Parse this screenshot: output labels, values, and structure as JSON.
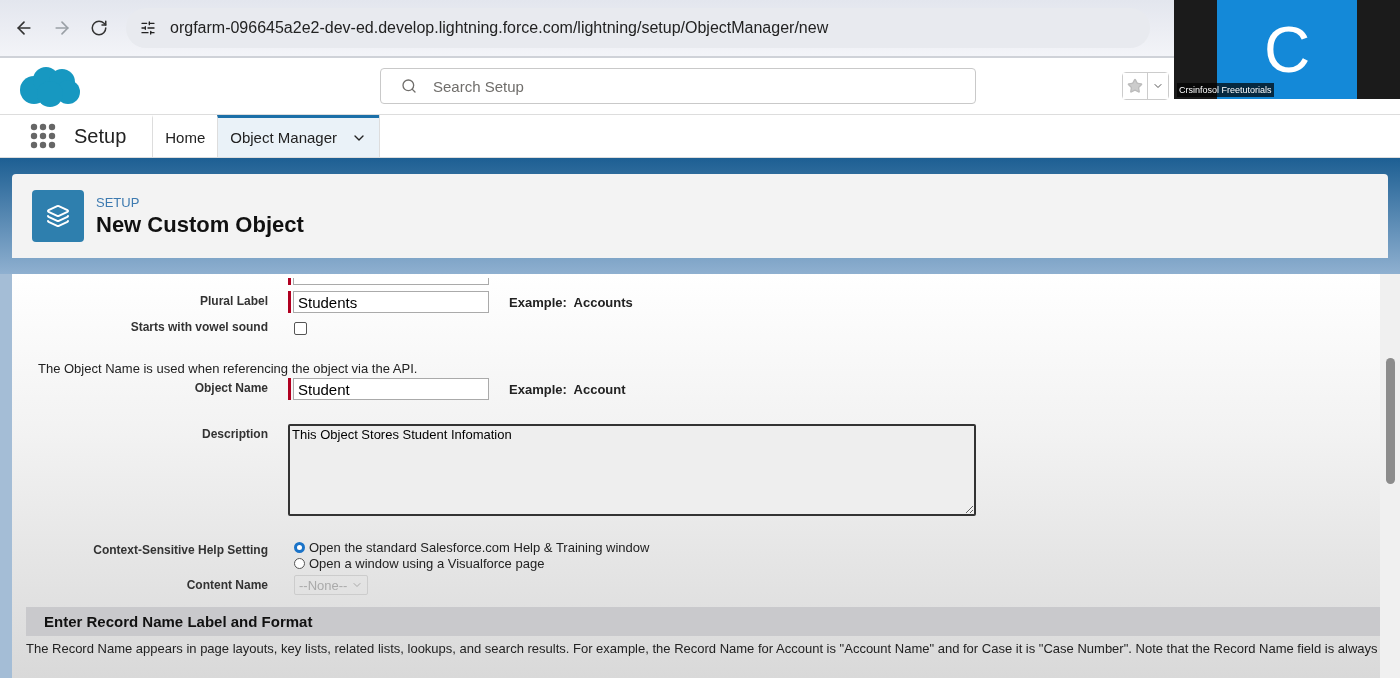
{
  "browser": {
    "url": "orgfarm-096645a2e2-dev-ed.develop.lightning.force.com/lightning/setup/ObjectManager/new"
  },
  "header": {
    "search": {
      "placeholder": "Search Setup"
    }
  },
  "video_tile": {
    "letter": "C",
    "name": "Crsinfosol Freetutorials"
  },
  "nav": {
    "app_name": "Setup",
    "tabs": [
      {
        "label": "Home",
        "selected": false,
        "dropdown": false
      },
      {
        "label": "Object Manager",
        "selected": true,
        "dropdown": true
      }
    ]
  },
  "page_header": {
    "eyebrow": "SETUP",
    "title": "New Custom Object"
  },
  "form": [
    {
      "kind": "cutfield",
      "required": true
    },
    {
      "kind": "text",
      "label": "Plural Label",
      "value": "Students",
      "required": true,
      "example": "Example:  Accounts"
    },
    {
      "kind": "checkbox",
      "label": "Starts with vowel sound",
      "checked": false
    },
    {
      "kind": "note",
      "text": "The Object Name is used when referencing the object via the API."
    },
    {
      "kind": "text",
      "label": "Object Name",
      "value": "Student",
      "required": true,
      "example": "Example:  Account"
    },
    {
      "kind": "textarea",
      "label": "Description",
      "value": "This Object Stores Student Infomation"
    },
    {
      "kind": "radio",
      "label": "Context-Sensitive Help Setting",
      "options": [
        {
          "label": "Open the standard Salesforce.com Help & Training window",
          "selected": true
        },
        {
          "label": "Open a window using a Visualforce page",
          "selected": false
        }
      ]
    },
    {
      "kind": "select",
      "label": "Content Name",
      "value": "--None--",
      "disabled": true
    }
  ],
  "section": {
    "title": "Enter Record Name Label and Format",
    "text": "The Record Name appears in page layouts, key lists, related lists, lookups, and search results. For example, the Record Name for Account is \"Account Name\" and for Case it is \"Case Number\". Note that the Record Name field is always"
  }
}
